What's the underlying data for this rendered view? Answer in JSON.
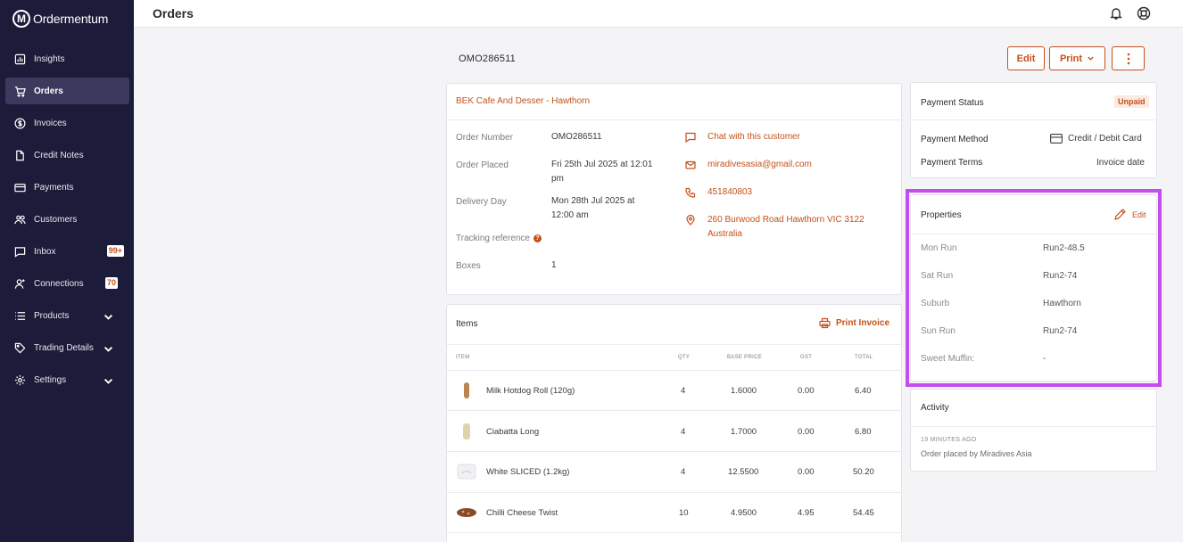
{
  "app": {
    "name": "Ordermentum",
    "logo_letter": "M"
  },
  "sidebar": {
    "items": [
      {
        "label": "Insights",
        "icon": "chart-icon"
      },
      {
        "label": "Orders",
        "icon": "cart-icon"
      },
      {
        "label": "Invoices",
        "icon": "dollar-icon"
      },
      {
        "label": "Credit Notes",
        "icon": "document-icon"
      },
      {
        "label": "Payments",
        "icon": "card-icon"
      },
      {
        "label": "Customers",
        "icon": "people-icon"
      },
      {
        "label": "Inbox",
        "icon": "chat-icon",
        "badge": "99+"
      },
      {
        "label": "Connections",
        "icon": "person-add-icon",
        "badge": "70"
      },
      {
        "label": "Products",
        "icon": "list-icon"
      },
      {
        "label": "Trading Details",
        "icon": "tag-icon"
      },
      {
        "label": "Settings",
        "icon": "gear-icon"
      }
    ],
    "active": "Orders"
  },
  "header": {
    "title": "Orders"
  },
  "order": {
    "number": "OMO286511",
    "buttons": {
      "edit": "Edit",
      "print": "Print"
    },
    "customer": "BEK Cafe And Desser - Hawthorn",
    "details": {
      "order_number_label": "Order Number",
      "order_number": "OMO286511",
      "order_placed_label": "Order Placed",
      "order_placed": "Fri 25th Jul 2025 at 12:01 pm",
      "delivery_day_label": "Delivery Day",
      "delivery_day": "Mon 28th Jul 2025 at 12:00 am",
      "tracking_label": "Tracking reference",
      "boxes_label": "Boxes",
      "boxes": "1"
    },
    "contact": {
      "chat": "Chat with this customer",
      "email": "miradivesasia@gmail.com",
      "phone": "451840803",
      "address": "260 Burwood Road Hawthorn VIC 3122 Australia"
    }
  },
  "items": {
    "title": "Items",
    "print_invoice": "Print Invoice",
    "columns": [
      "ITEM",
      "QTY",
      "BASE PRICE",
      "GST",
      "TOTAL"
    ],
    "rows": [
      {
        "name": "Milk Hotdog Roll (120g)",
        "qty": "4",
        "base_price": "1.6000",
        "gst": "0.00",
        "total": "6.40"
      },
      {
        "name": "Ciabatta Long",
        "qty": "4",
        "base_price": "1.7000",
        "gst": "0.00",
        "total": "6.80"
      },
      {
        "name": "White SLICED (1.2kg)",
        "qty": "4",
        "base_price": "12.5500",
        "gst": "0.00",
        "total": "50.20"
      },
      {
        "name": "Chilli Cheese Twist",
        "qty": "10",
        "base_price": "4.9500",
        "gst": "4.95",
        "total": "54.45"
      }
    ]
  },
  "payment": {
    "status_label": "Payment Status",
    "status": "Unpaid",
    "method_label": "Payment Method",
    "method": "Credit / Debit Card",
    "terms_label": "Payment Terms",
    "terms": "Invoice date"
  },
  "properties": {
    "title": "Properties",
    "edit": "Edit",
    "rows": [
      {
        "label": "Mon Run",
        "value": "Run2-48.5"
      },
      {
        "label": "Sat Run",
        "value": "Run2-74"
      },
      {
        "label": "Suburb",
        "value": "Hawthorn"
      },
      {
        "label": "Sun Run",
        "value": "Run2-74"
      },
      {
        "label": "Sweet Muffin:",
        "value": "-"
      }
    ]
  },
  "activity": {
    "title": "Activity",
    "time": "19 MINUTES AGO",
    "text": "Order placed by Miradives Asia"
  },
  "colors": {
    "accent": "#c5501a",
    "sidebar": "#1c1b3a",
    "highlight": "#c44dee"
  }
}
